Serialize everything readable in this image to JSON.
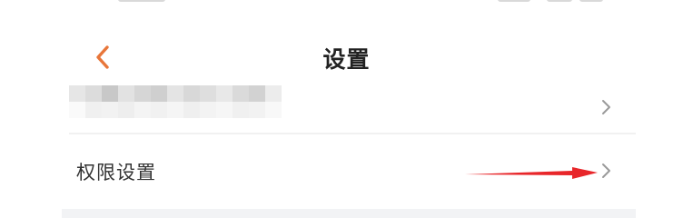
{
  "header": {
    "title": "设置",
    "back_icon": "chevron-left-icon",
    "accent_color": "#e8763a"
  },
  "settings": {
    "account_row": {
      "content": "",
      "redacted": true,
      "chevron_icon": "chevron-right-icon"
    },
    "permissions_row": {
      "label": "权限设置",
      "chevron_icon": "chevron-right-icon"
    }
  },
  "annotation": {
    "arrow_color": "#e8262a",
    "arrow_icon": "red-arrow-icon"
  }
}
